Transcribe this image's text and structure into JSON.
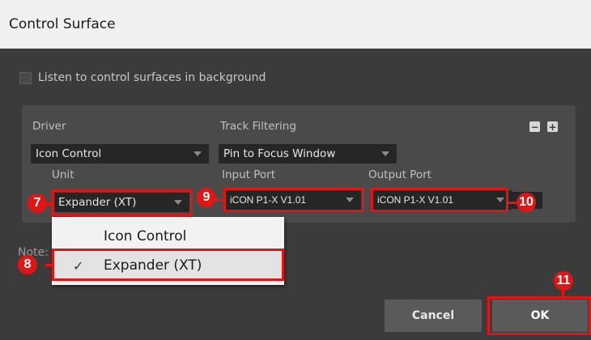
{
  "window": {
    "title": "Control Surface"
  },
  "background_listen": {
    "label": "Listen to control surfaces in background",
    "checked": false
  },
  "surface": {
    "driver_label": "Driver",
    "driver_value": "Icon Control",
    "track_filtering_label": "Track Filtering",
    "track_filtering_value": "Pin to Focus Window",
    "unit_label": "Unit",
    "unit_value": "Expander (XT)",
    "input_port_label": "Input Port",
    "input_port_value": "iCON P1-X V1.01",
    "output_port_label": "Output Port",
    "output_port_value": "iCON P1-X V1.01",
    "remove_button": "−",
    "add_button": "+"
  },
  "unit_dropdown": {
    "options": [
      "Icon Control",
      "Expander (XT)"
    ],
    "selected": "Expander (XT)",
    "check_glyph": "✓"
  },
  "note_label": "Note:",
  "buttons": {
    "cancel": "Cancel",
    "ok": "OK"
  },
  "callouts": {
    "unit": "7",
    "dropdown_item": "8",
    "input_port": "9",
    "output_port": "10",
    "ok": "11"
  },
  "annotation_color": "#e01616"
}
